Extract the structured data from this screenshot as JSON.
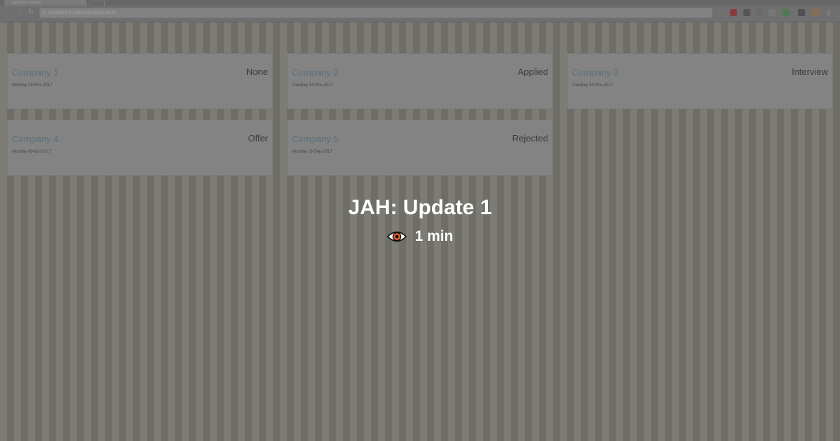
{
  "browser": {
    "tab_title": "Application Tracker",
    "address": "localhost:51591/JobApplication"
  },
  "cards": [
    {
      "company": "Company 1",
      "status": "None",
      "date": "Monday 13-Nov-2017"
    },
    {
      "company": "Company 2",
      "status": "Applied",
      "date": "Tuesday 14-Nov-2017"
    },
    {
      "company": "Company 3",
      "status": "Interview",
      "date": "Tuesday 14-Nov-2017"
    },
    {
      "company": "Company 4",
      "status": "Offer",
      "date": "Monday 09-Oct-2017"
    },
    {
      "company": "Company 5",
      "status": "Rejected",
      "date": "Monday 18-Sep-2017"
    }
  ],
  "overlay": {
    "title": "JAH: Update 1",
    "read_time": "1 min",
    "icon": "eye-icon"
  },
  "colors": {
    "accent": "#e8642c",
    "overlay_text": "#ffffff"
  }
}
